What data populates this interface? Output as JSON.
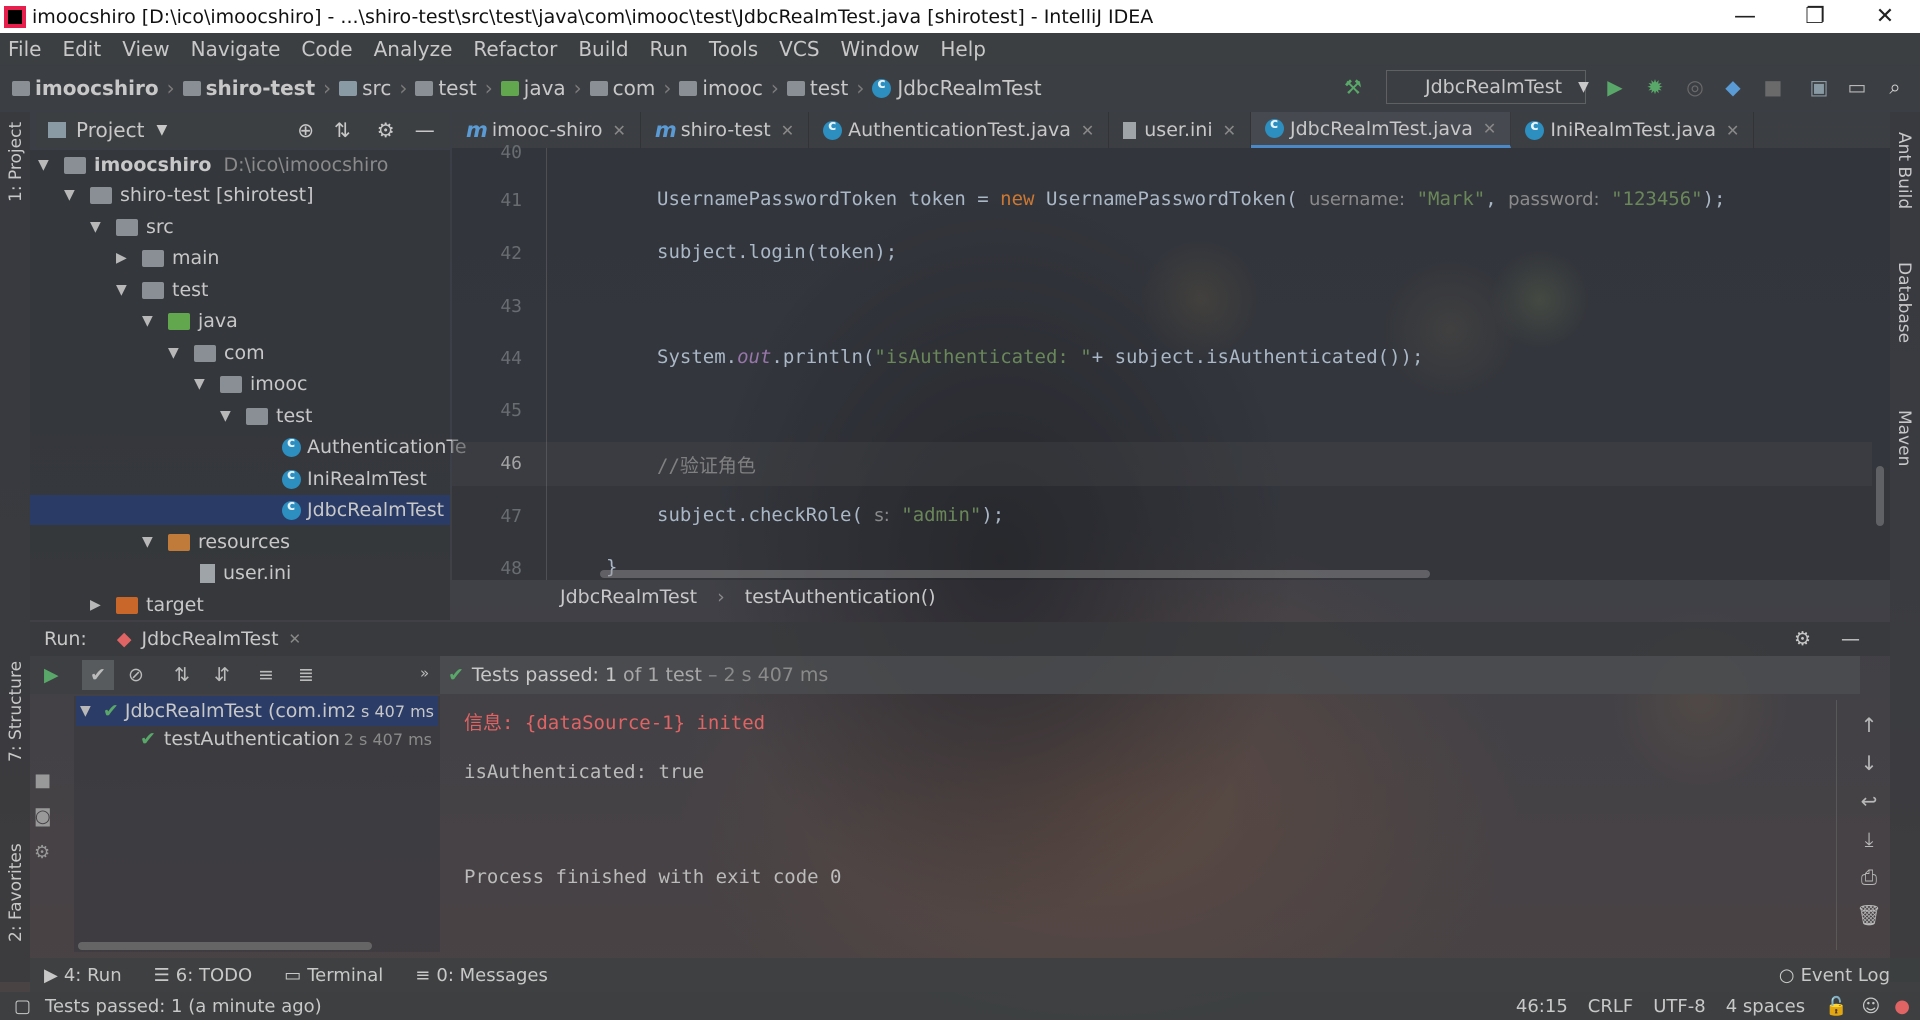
{
  "window": {
    "title": "imoocshiro [D:\\ico\\imoocshiro] - ...\\shiro-test\\src\\test\\java\\com\\imooc\\test\\JdbcRealmTest.java [shirotest] - IntelliJ IDEA",
    "minimize": "—",
    "restore": "❐",
    "close": "✕"
  },
  "menu": [
    "File",
    "Edit",
    "View",
    "Navigate",
    "Code",
    "Analyze",
    "Refactor",
    "Build",
    "Run",
    "Tools",
    "VCS",
    "Window",
    "Help"
  ],
  "breadcrumbs": [
    "imoocshiro",
    "shiro-test",
    "src",
    "test",
    "java",
    "com",
    "imooc",
    "test",
    "JdbcRealmTest"
  ],
  "run_config": "JdbcRealmTest",
  "project_panel": {
    "title": "Project",
    "tree": [
      {
        "label": "imoocshiro",
        "extra": "D:\\ico\\imoocshiro",
        "kind": "folder"
      },
      {
        "label": "shiro-test [shirotest]",
        "kind": "folder"
      },
      {
        "label": "src",
        "kind": "folder"
      },
      {
        "label": "main",
        "kind": "folder"
      },
      {
        "label": "test",
        "kind": "folder"
      },
      {
        "label": "java",
        "kind": "java"
      },
      {
        "label": "com",
        "kind": "folder"
      },
      {
        "label": "imooc",
        "kind": "folder"
      },
      {
        "label": "test",
        "kind": "folder"
      },
      {
        "label": "AuthenticationTe",
        "kind": "class"
      },
      {
        "label": "IniRealmTest",
        "kind": "class"
      },
      {
        "label": "JdbcRealmTest",
        "kind": "class",
        "selected": true
      },
      {
        "label": "resources",
        "kind": "res"
      },
      {
        "label": "user.ini",
        "kind": "file"
      },
      {
        "label": "target",
        "kind": "tgt"
      }
    ]
  },
  "left_stripe": {
    "project": "1: Project",
    "structure": "7: Structure",
    "favorites": "2: Favorites"
  },
  "right_stripe": {
    "ant": "Ant Build",
    "database": "Database",
    "maven": "Maven"
  },
  "tabs": [
    {
      "label": "imooc-shiro",
      "icon": "m"
    },
    {
      "label": "shiro-test",
      "icon": "m"
    },
    {
      "label": "AuthenticationTest.java",
      "icon": "class"
    },
    {
      "label": "user.ini",
      "icon": "ini"
    },
    {
      "label": "JdbcRealmTest.java",
      "icon": "class",
      "active": true
    },
    {
      "label": "IniRealmTest.java",
      "icon": "class"
    }
  ],
  "editor": {
    "line_numbers": [
      "40",
      "41",
      "42",
      "43",
      "44",
      "45",
      "46",
      "47",
      "48"
    ],
    "l41": {
      "a": "UsernamePasswordToken token = ",
      "kw": "new",
      "b": " UsernamePasswordToken( ",
      "h1": "username:",
      "s1": "\"Mark\"",
      "c": ", ",
      "h2": "password:",
      "s2": "\"123456\"",
      "d": ");"
    },
    "l42": "subject.login(token);",
    "l44": {
      "a": "System.",
      "fld": "out",
      "b": ".println(",
      "s": "\"isAuthenticated: \"",
      "c": "+ subject.isAuthenticated());"
    },
    "l46": "//验证角色",
    "l47": {
      "a": "subject.checkRole( ",
      "h": "s:",
      "s": "\"admin\"",
      "b": ");"
    },
    "l48": "}",
    "crumb_class": "JdbcRealmTest",
    "crumb_method": "testAuthentication()"
  },
  "run": {
    "label": "Run:",
    "tab": "JdbcRealmTest",
    "status_prefix": "Tests passed:",
    "status_count": "1",
    "status_rest": "of 1 test",
    "status_time": "– 2 s 407 ms",
    "tree": [
      {
        "label": "JdbcRealmTest (com.im",
        "time": "2 s 407 ms"
      },
      {
        "label": "testAuthentication",
        "time": "2 s 407 ms"
      }
    ],
    "console": [
      {
        "text": "信息: {dataSource-1} inited",
        "red": true
      },
      {
        "text": "isAuthenticated: true",
        "red": false
      },
      {
        "text": "",
        "red": false
      },
      {
        "text": "Process finished with exit code 0",
        "red": false
      }
    ]
  },
  "bottom_tabs": [
    {
      "label": "4: Run"
    },
    {
      "label": "6: TODO"
    },
    {
      "label": "Terminal"
    },
    {
      "label": "0: Messages"
    }
  ],
  "event_log": "Event Log",
  "statusbar": {
    "message": "Tests passed: 1 (a minute ago)",
    "position": "46:15",
    "line_sep": "CRLF",
    "encoding": "UTF-8",
    "indent": "4 spaces"
  },
  "colors": {
    "accent": "#4a88c7",
    "green": "#59a869",
    "error": "#e06464",
    "keyword": "#cc7832",
    "string": "#6a8759"
  }
}
